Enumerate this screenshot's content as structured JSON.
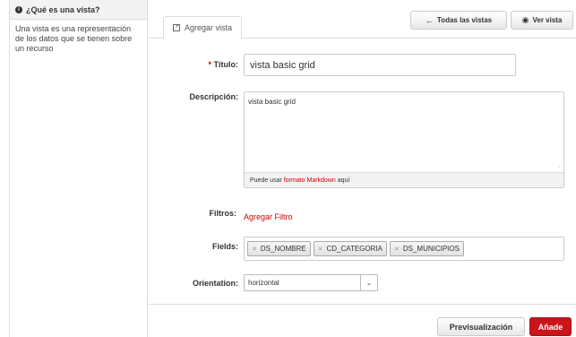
{
  "sidebar": {
    "title": "¿Qué es una vista?",
    "text": "Una vista es una representación de los datos que se tienen sobre un recurso"
  },
  "tabs": {
    "active_label": "Agregar vista"
  },
  "toolbar": {
    "all_views_label": "Todas las vistas",
    "view_label": "Ver vista"
  },
  "form": {
    "title_label": "Título:",
    "title_required": "*",
    "title_value": "vista basic grid",
    "description_label": "Descripción:",
    "description_value": "vista basic grid",
    "markdown_prefix": "Puede usar",
    "markdown_link": "formato Markdown",
    "markdown_suffix": "aquí",
    "filters_label": "Filtros:",
    "add_filter_link": "Agregar Filtro",
    "fields_label": "Fields:",
    "fields": [
      "DS_NOMBRE",
      "CD_CATEGORIA",
      "DS_MUNICIPIOS"
    ],
    "orientation_label": "Orientation:",
    "orientation_value": "horizontal"
  },
  "actions": {
    "preview_label": "Previsualización",
    "add_label": "Añade"
  },
  "colors": {
    "accent": "#c9141c"
  },
  "icons": {
    "sidebar": "info-icon",
    "tab": "edit-icon",
    "all_views": "arrow-left-icon",
    "view": "eye-icon"
  }
}
